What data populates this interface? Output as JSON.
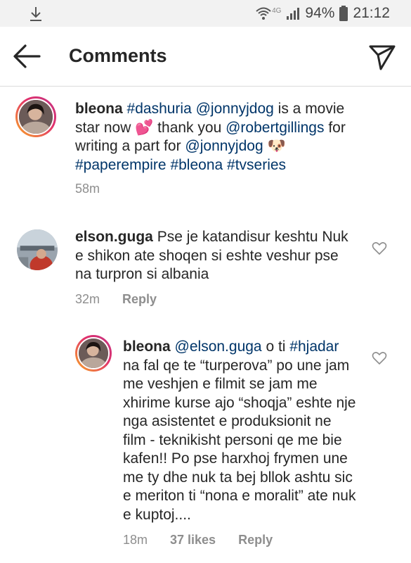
{
  "status_bar": {
    "network": "4G",
    "battery": "94%",
    "time": "21:12"
  },
  "header": {
    "title": "Comments"
  },
  "caption": {
    "username": "bleona",
    "tag1": "#dashuria",
    "mention1": "@jonnyjdog",
    "text1": " is a movie star now 💕 thank you ",
    "mention2": "@robertgillings",
    "text2": " for writing a part for ",
    "mention3": "@jonnyjdog",
    "text3": " 🐶 ",
    "tag2": "#paperempire",
    "tag3": "#bleona",
    "tag4": "#tvseries",
    "time": "58m"
  },
  "comments": [
    {
      "username": "elson.guga",
      "text": "Pse je katandisur keshtu Nuk e shikon ate shoqen si eshte veshur pse na turpron si albania",
      "time": "32m",
      "reply_label": "Reply"
    }
  ],
  "reply": {
    "username": "bleona",
    "mention": "@elson.guga",
    "text1": " o ti ",
    "tag": "#hjadar",
    "text2": " na fal qe te “turperova” po une jam me veshjen e filmit se jam me xhirime kurse ajo “shoqja” es­hte nje nga asistentet e produk­sionit ne film - teknikisht personi qe me bie kafen!! Po pse harxhoj frymen une me ty dhe nuk ta bej bllok ashtu sic e meriton ti “nona e moralit” ate nuk e kuptoj....",
    "time": "18m",
    "likes": "37 likes",
    "reply_label": "Reply"
  }
}
